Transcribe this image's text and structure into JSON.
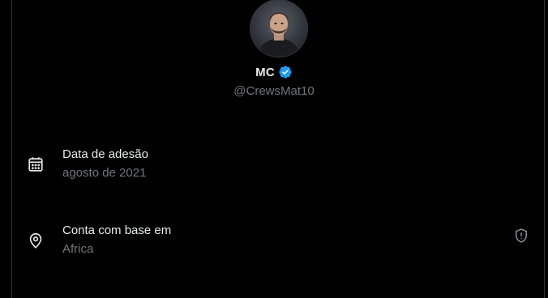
{
  "profile": {
    "display_name": "MC",
    "handle": "@CrewsMat10",
    "verified": true,
    "verified_color": "#1d9bf0"
  },
  "about": {
    "joined": {
      "icon": "calendar-icon",
      "title": "Data de adesão",
      "value": "agosto de 2021"
    },
    "location": {
      "icon": "location-pin-icon",
      "title": "Conta com base em",
      "value": "Africa",
      "trailing_icon": "shield-alert-icon"
    }
  },
  "colors": {
    "background": "#000000",
    "primary_text": "#e7e9ea",
    "secondary_text": "#71767b",
    "border": "#2f3336"
  }
}
